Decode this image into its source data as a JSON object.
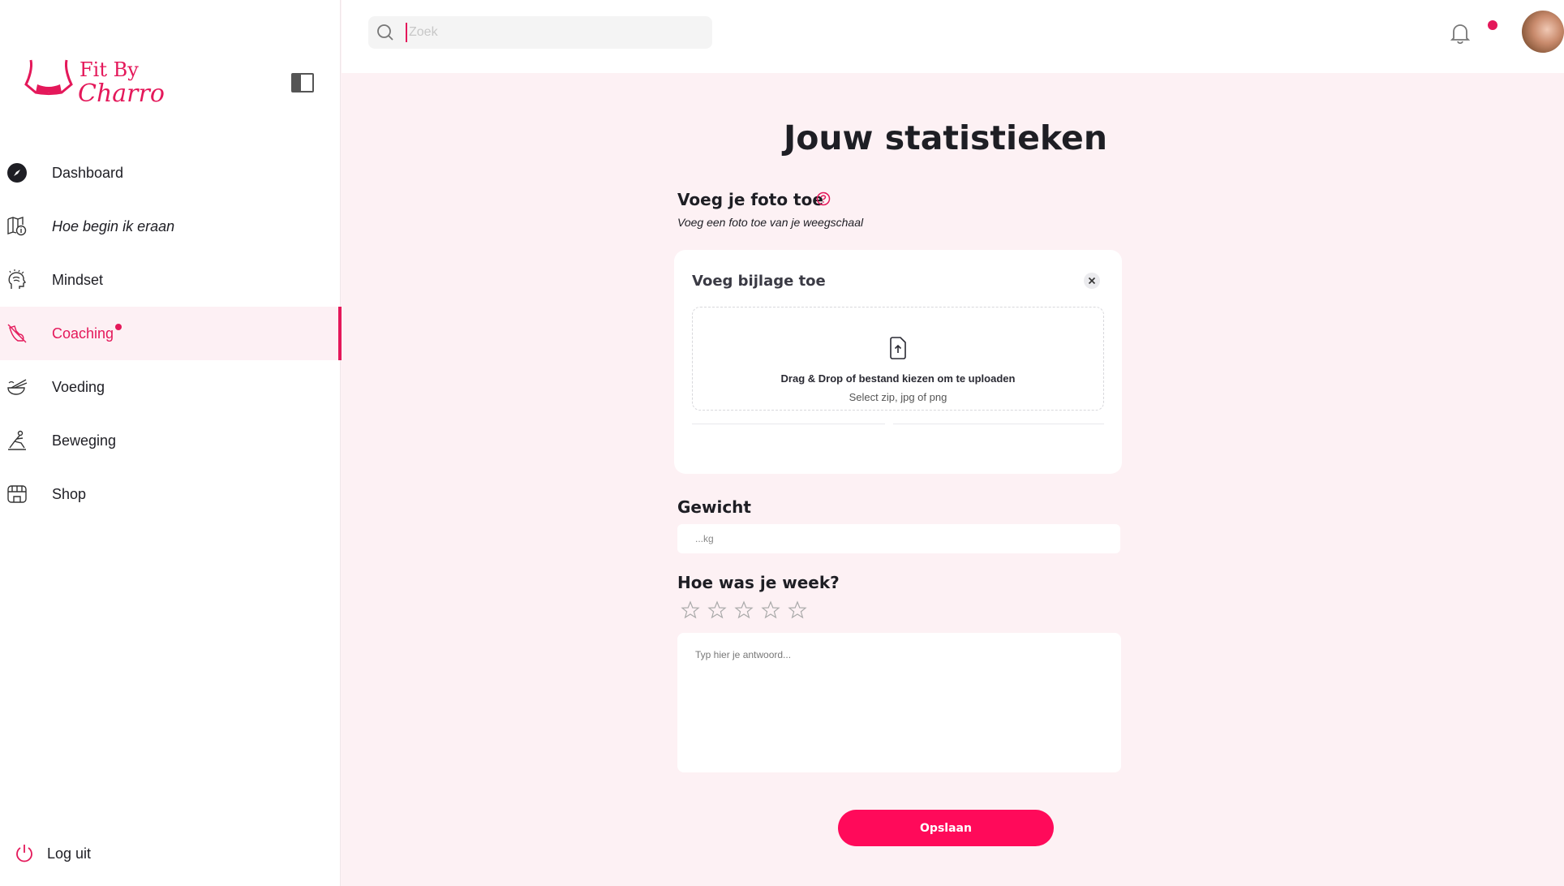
{
  "brand": {
    "line1": "Fit By",
    "line2": "Charro",
    "accent": "#e4185a"
  },
  "sidebar": {
    "items": [
      {
        "label": "Dashboard",
        "icon": "compass-icon"
      },
      {
        "label": "Hoe begin ik eraan",
        "icon": "map-info-icon"
      },
      {
        "label": "Mindset",
        "icon": "head-icon"
      },
      {
        "label": "Coaching",
        "icon": "muscle-icon",
        "active": true,
        "notification": true
      },
      {
        "label": "Voeding",
        "icon": "food-icon"
      },
      {
        "label": "Beweging",
        "icon": "exercise-icon"
      },
      {
        "label": "Shop",
        "icon": "store-icon"
      }
    ],
    "logout_label": "Log uit"
  },
  "search": {
    "placeholder": "Zoek",
    "value": ""
  },
  "main": {
    "title": "Jouw statistieken",
    "photo": {
      "title": "Voeg je foto toe",
      "subtitle": "Voeg een foto toe van je weegschaal"
    },
    "upload": {
      "title": "Voeg bijlage toe",
      "drop_text": "Drag & Drop of bestand kiezen om te uploaden",
      "drop_sub": "Select zip, jpg of png"
    },
    "weight": {
      "title": "Gewicht",
      "placeholder": "...kg",
      "value": ""
    },
    "week": {
      "title": "Hoe was je week?",
      "rating": 0,
      "max_rating": 5,
      "answer_placeholder": "Typ hier je antwoord..."
    },
    "save_label": "Opslaan"
  },
  "colors": {
    "accent": "#e4185a",
    "button": "#ff0a5a",
    "background": "#fdf1f4"
  }
}
